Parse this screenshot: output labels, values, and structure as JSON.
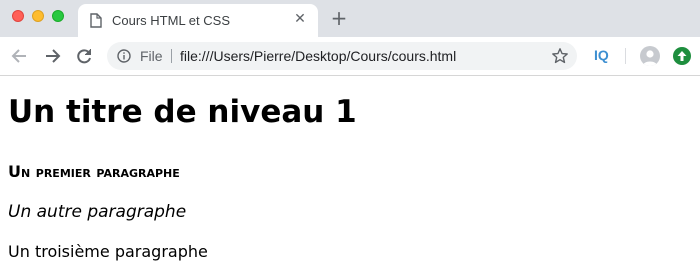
{
  "tab": {
    "title": "Cours HTML et CSS",
    "favicon": "document-icon",
    "close_symbol": "✕"
  },
  "new_tab_symbol": "+",
  "toolbar": {
    "back_icon": "arrow-left-icon",
    "forward_icon": "arrow-right-icon",
    "reload_icon": "reload-icon",
    "omnibox": {
      "security_icon": "info-icon",
      "scheme_label": "File",
      "url": "file:///Users/Pierre/Desktop/Cours/cours.html",
      "bookmark_icon": "star-icon"
    },
    "extension_label": "IQ",
    "profile_icon": "avatar-icon",
    "update_icon": "update-arrow-icon"
  },
  "content": {
    "heading1": "Un titre de niveau 1",
    "paragraph1": "Un premier paragraphe",
    "paragraph2": "Un autre paragraphe",
    "paragraph3": "Un troisième paragraphe"
  },
  "colors": {
    "tabbar_bg": "#dee1e6",
    "omnibox_bg": "#f1f3f4",
    "traffic_close": "#ff5f57",
    "traffic_minimize": "#febc2e",
    "traffic_maximize": "#28c840",
    "extension_accent": "#3d8fd1",
    "update_green": "#1e8e3e"
  }
}
